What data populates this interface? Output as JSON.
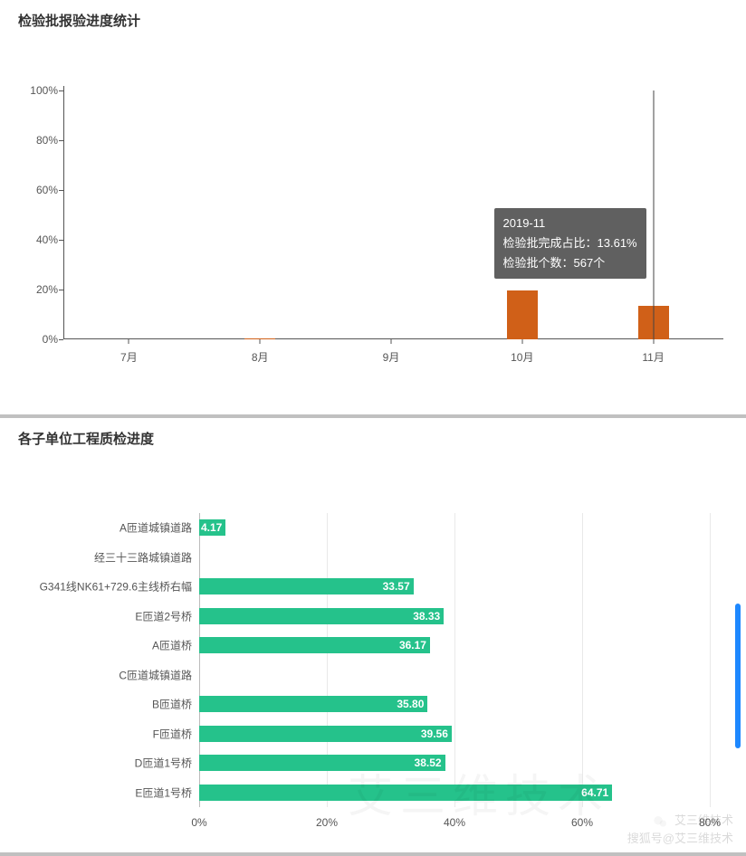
{
  "panel1": {
    "title": "检验批报验进度统计"
  },
  "panel2": {
    "title": "各子单位工程质检进度"
  },
  "tooltip": {
    "title": "2019-11",
    "line1": "检验批完成占比：13.61%",
    "line2": "检验批个数：567个"
  },
  "watermark": {
    "line1": "艾三维技术",
    "line2": "搜狐号@艾三维技术"
  },
  "chart_data": [
    {
      "type": "bar",
      "title": "检验批报验进度统计",
      "xlabel": "",
      "ylabel": "",
      "ylim": [
        0,
        100
      ],
      "y_ticks_percent_suffix": true,
      "categories": [
        "7月",
        "8月",
        "9月",
        "10月",
        "11月"
      ],
      "values": [
        0,
        0.3,
        0,
        19.5,
        13.61
      ],
      "hover_index": 4,
      "hover_detail": {
        "period": "2019-11",
        "percent": 13.61,
        "count": 567,
        "count_unit": "个"
      },
      "bar_color": "#d06018"
    },
    {
      "type": "bar",
      "orientation": "horizontal",
      "title": "各子单位工程质检进度",
      "xlabel": "",
      "ylabel": "",
      "xlim": [
        0,
        80
      ],
      "x_ticks_percent_suffix": true,
      "categories": [
        "A匝道城镇道路",
        "经三十三路城镇道路",
        "G341线NK61+729.6主线桥右幅",
        "E匝道2号桥",
        "A匝道桥",
        "C匝道城镇道路",
        "B匝道桥",
        "F匝道桥",
        "D匝道1号桥",
        "E匝道1号桥"
      ],
      "values": [
        4.17,
        0,
        33.57,
        38.33,
        36.17,
        0,
        35.8,
        39.56,
        38.52,
        64.71
      ],
      "bar_color": "#25c28b"
    }
  ]
}
